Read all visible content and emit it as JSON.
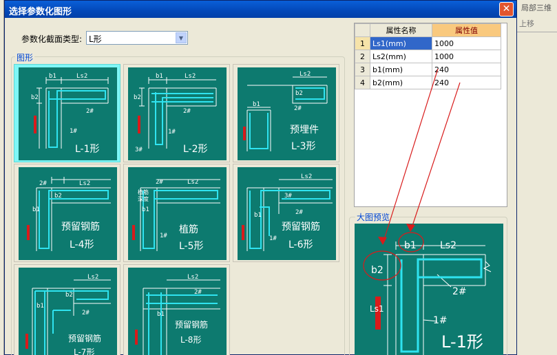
{
  "window": {
    "title": "选择参数化图形",
    "close_glyph": "✕"
  },
  "background_app": {
    "label_1": "局部三维",
    "label_2": "上移",
    "left_marker": "x"
  },
  "section_type": {
    "label": "参数化截面类型:",
    "value": "L形"
  },
  "shapes": {
    "group_label": "图形",
    "items": [
      {
        "name": "L-1形",
        "selected": true
      },
      {
        "name": "L-2形"
      },
      {
        "name": "L-3形",
        "subtitle": "预埋件"
      },
      {
        "name": "L-4形",
        "subtitle": "预留钢筋"
      },
      {
        "name": "L-5形",
        "subtitle": "植筋"
      },
      {
        "name": "L-6形",
        "subtitle": "预留钢筋"
      },
      {
        "name": "L-7形",
        "subtitle": "预留钢筋"
      },
      {
        "name": "L-8形",
        "subtitle": "预留钢筋"
      }
    ],
    "note_mark": "植筋\n深度"
  },
  "properties": {
    "headers": [
      "属性名称",
      "属性值"
    ],
    "rows": [
      {
        "index": "1",
        "name": "Ls1(mm)",
        "value": "1000",
        "selected": true
      },
      {
        "index": "2",
        "name": "Ls2(mm)",
        "value": "1000"
      },
      {
        "index": "3",
        "name": "b1(mm)",
        "value": "240"
      },
      {
        "index": "4",
        "name": "b2(mm)",
        "value": "240"
      }
    ]
  },
  "preview": {
    "group_label": "大图预览",
    "caption": "L-1形",
    "labels": {
      "b1": "b1",
      "b2": "b2",
      "ls1": "Ls1",
      "ls2": "Ls2",
      "bar1": "1#",
      "bar2": "2#"
    }
  },
  "colors": {
    "panel": "#0d7a6f",
    "bar": "#2fe3f0",
    "annotation": "#d81b1b",
    "selection": "#3167c9"
  }
}
